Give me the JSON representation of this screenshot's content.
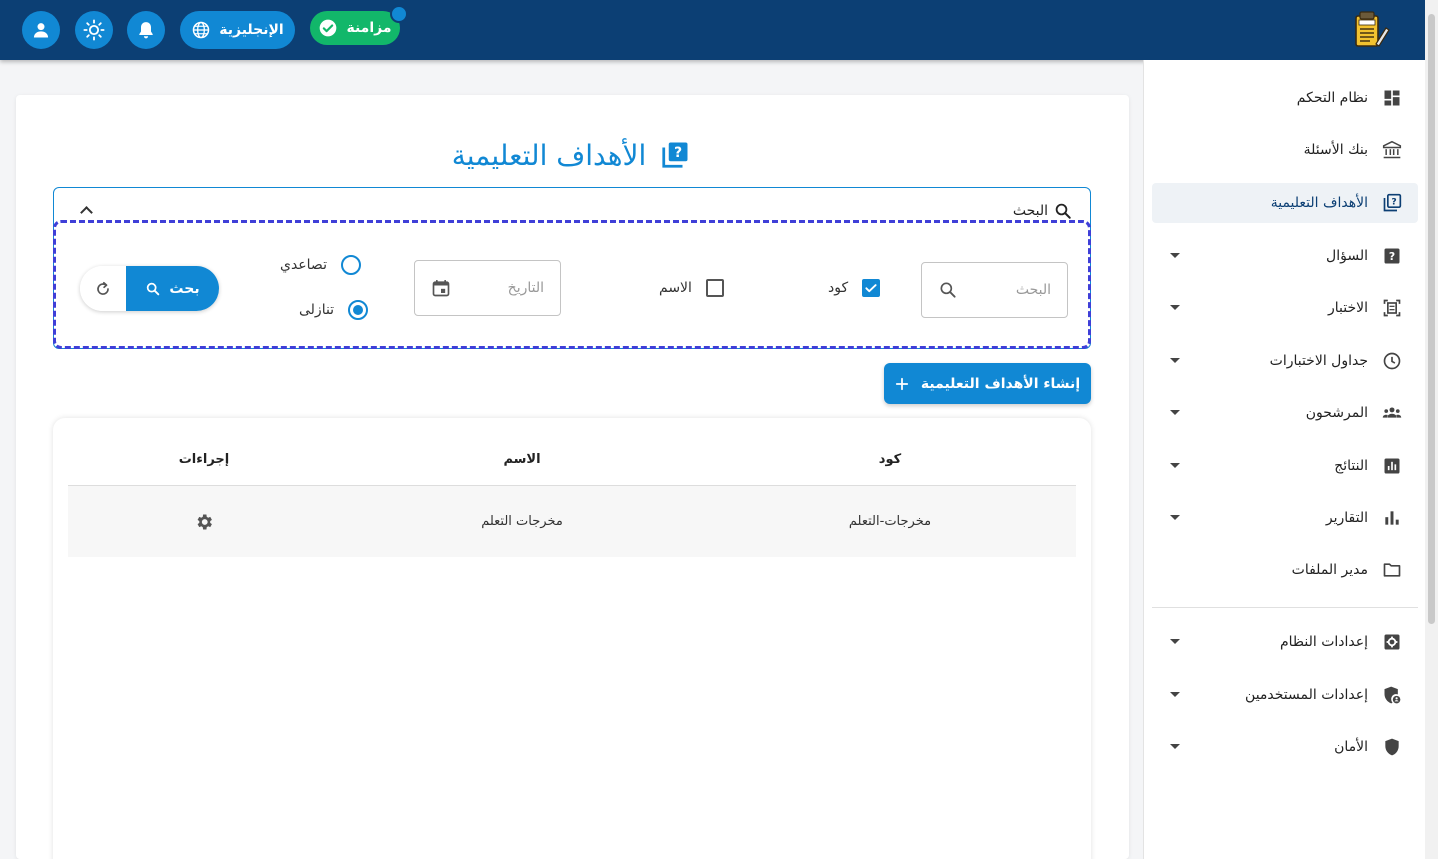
{
  "colors": {
    "primary": "#1188d4",
    "navbar": "#0c3f74",
    "success": "#12b76a",
    "dash": "#3f3fd8"
  },
  "topbar": {
    "sync_label": "مزامنة",
    "language_label": "الإنجليزية",
    "icons": [
      "user-icon",
      "theme-icon",
      "bell-icon",
      "globe-icon",
      "check-icon"
    ],
    "logo_icon": "exam-logo"
  },
  "sidebar": {
    "items": [
      {
        "label": "نظام التحكم",
        "icon": "dashboard-icon"
      },
      {
        "label": "بنك الأسئلة",
        "icon": "bank-icon"
      },
      {
        "label": "الأهداف التعليمية",
        "icon": "objectives-icon",
        "active": true
      },
      {
        "label": "السؤال",
        "icon": "question-icon"
      },
      {
        "label": "الاختبار",
        "icon": "exam-icon"
      },
      {
        "label": "جداول الاختبارات",
        "icon": "clock-icon"
      },
      {
        "label": "المرشحون",
        "icon": "people-icon"
      },
      {
        "label": "النتائج",
        "icon": "results-icon"
      },
      {
        "label": "التقارير",
        "icon": "reports-icon"
      },
      {
        "label": "مدير الملفات",
        "icon": "folder-icon"
      },
      {
        "label": "إعدادات النظام",
        "icon": "settings-icon"
      },
      {
        "label": "إعدادات المستخدمين",
        "icon": "user-shield-icon"
      },
      {
        "label": "الأمان",
        "icon": "shield-icon"
      }
    ]
  },
  "page": {
    "title": "الأهداف التعليمية"
  },
  "search": {
    "panel_label": "البحث",
    "input_placeholder": "البحث",
    "code_label": "كود",
    "code_checked": true,
    "name_label": "الاسم",
    "name_checked": false,
    "date_placeholder": "التاريخ",
    "asc_label": "تصاعدي",
    "desc_label": "تنازلى",
    "selected_order": "desc",
    "search_button": "بحث"
  },
  "create_button": "إنشاء الأهداف التعليمية",
  "table": {
    "headers": {
      "code": "كود",
      "name": "الاسم",
      "actions": "إجراءات"
    },
    "rows": [
      {
        "code": "مخرجات-التعلم",
        "name": "مخرجات التعلم"
      }
    ]
  }
}
